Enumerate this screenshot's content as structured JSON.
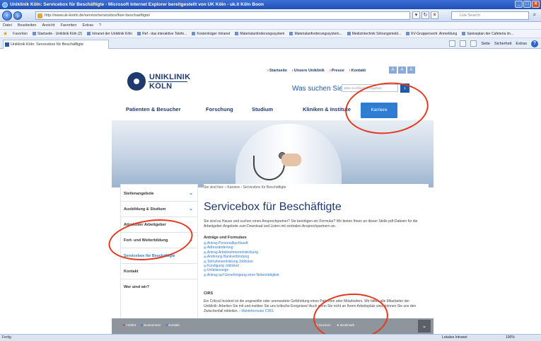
{
  "window": {
    "title": "Uniklinik Köln: Servicebox für Beschäftigte - Microsoft Internet Explorer bereitgestellt von UK Köln - uk.it Köln Boon"
  },
  "browser": {
    "url": "http://www.uk-koeln.de/service/servicebox/fuer-beschaeftigte/",
    "search_placeholder": "Live Search",
    "menu": [
      "Datei",
      "Bearbeiten",
      "Ansicht",
      "Favoriten",
      "Extras",
      "?"
    ],
    "favorites_label": "Favoriten",
    "favorites": [
      "Startseite - Uniklinik Köln (2)",
      "Intranet der Uniklinik Köln",
      "Ref - das interaktive Telefo...",
      "Kostenträger Intranet",
      "Materialanforderungssystem",
      "Materialanforderungssystem...",
      "Medizintechnik Störungsmeld...",
      "KV-Gruppenvertr. Anmeldung",
      "Speiseplan der Cafeteria im..."
    ],
    "tab_title": "Uniklinik Köln: Servicebox für Beschäftigte",
    "commands": [
      "Seite",
      "Sicherheit",
      "Extras"
    ],
    "status_left": "Fertig",
    "status_zone": "Lokales Intranet",
    "status_zoom": "100%"
  },
  "header": {
    "logo_line1": "UNIKLINIK",
    "logo_line2": "KÖLN",
    "toplinks": [
      "Startseite",
      "Unsere Uniklinik",
      "Presse",
      "Kontakt"
    ],
    "fontsize_buttons": [
      "A",
      "A",
      "A"
    ],
    "search_label": "Was suchen Sie?",
    "search_placeholder": "Bitte Suchbegriff eingeben"
  },
  "mainnav": {
    "items": [
      "Patienten & Besucher",
      "Forschung",
      "Studium",
      "Kliniken & Institute"
    ],
    "active": "Karriere"
  },
  "sidebar": {
    "items": [
      {
        "label": "Stellenangebote",
        "chevron": "⌄"
      },
      {
        "label": "Ausbildung & Studium",
        "chevron": "⌄"
      },
      {
        "label": "Attraktiver Arbeitgeber",
        "chevron": ""
      },
      {
        "label": "Fort- und Weiterbildung",
        "chevron": "⌄"
      },
      {
        "label": "Servicebox für Beschäftigte",
        "chevron": ""
      },
      {
        "label": "Kontakt",
        "chevron": ""
      },
      {
        "label": "Wer sind wir?",
        "chevron": ""
      }
    ]
  },
  "article": {
    "breadcrumb": "Sie sind hier: › Karriere › Servicebox für Beschäftigte",
    "title": "Servicebox für Beschäftigte",
    "intro": "Sie sind zu Hause und suchen einen Ansprechpartner? Sie benötigen ein Formular? Wir bieten Ihnen an dieser Stelle pdf-Dateien für die Arbeitgeber-Angebote zum Download und Listen mit zentralen Ansprechpartnern an.",
    "forms_title": "Anträge und Formulare",
    "links": [
      "Antrag Personalbuchkauft",
      "Adressänderung",
      "Antrag Arbeitnehmerentwicklung",
      "Änderung Bankverbindung",
      "Teilnahmeerklärung Jobticket",
      "Kündigung Jobticket",
      "Unfallanzeige",
      "Antrag auf Genehmigung einer Nebentätigkeit"
    ],
    "cirs_title": "CIRS",
    "cirs_text": "Ein Critical Incident ist die ungewollte oder unerwartete Gefährdung eines Patienten oder Mitarbeiters. Wir bitten alle Mitarbeiter der Uniklinik: Arbeiten Sie mit und melden Sie uns kritische Ereignisse! Auch wenn Sie nicht an Ihrem Arbeitsplatz sind, können Sie uns den Zwischenfall mitteilen.",
    "cirs_link": "Meldeformular CIRS"
  },
  "footer": {
    "left": [
      "Anfahrt",
      "Busnummer",
      "Kontakt"
    ],
    "mid": [
      "Drucken",
      "Bookmark"
    ],
    "scroll_top": "⌄"
  },
  "annotations_color": "#e33a1f"
}
